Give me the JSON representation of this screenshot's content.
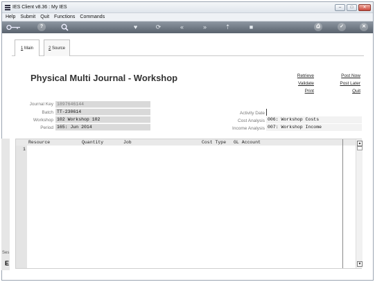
{
  "window": {
    "title": "IES Client v8.36 : My IES",
    "min_label": "–",
    "max_label": "□",
    "close_label": "✕"
  },
  "menu": [
    {
      "label": "Help"
    },
    {
      "label": "Submit"
    },
    {
      "label": "Quit"
    },
    {
      "label": "Functions"
    },
    {
      "label": "Commands"
    }
  ],
  "toolbar": {
    "icons": [
      "key-icon",
      "help-icon",
      "search-icon",
      "heart-icon",
      "refresh-icon",
      "rewind-icon",
      "fast-forward-icon",
      "upload-icon",
      "stop-icon",
      "print-icon",
      "ok-icon",
      "close-icon"
    ]
  },
  "tabs": {
    "main_label": "1 Main",
    "main_key": "1",
    "main_rest": " Main",
    "source_key": "2",
    "source_rest": " Source"
  },
  "page": {
    "title": "Physical Multi Journal - Workshop"
  },
  "actions": {
    "retrieve": "Retrieve",
    "validate": "Validate",
    "print": "Print",
    "post_now": "Post Now",
    "post_later": "Post Later",
    "quit": "Quit"
  },
  "fields": {
    "journal_key_label": "Journal Key",
    "journal_key_value": "1897646144",
    "batch_label": "Batch",
    "batch_value": "TT-230614",
    "workshop_label": "Workshop",
    "workshop_value": "102 Workshop 102",
    "period_label": "Period",
    "period_value": "165: Jun 2014",
    "activity_date_label": "Activity Date",
    "activity_date_value": "",
    "cost_analysis_label": "Cost Analysis",
    "cost_analysis_value": "006: Workshop Costs",
    "income_analysis_label": "Income Analysis",
    "income_analysis_value": "007: Workshop Income"
  },
  "grid": {
    "columns": [
      "Resource",
      "Quantity",
      "Job",
      "Cost Type",
      "GL Account"
    ],
    "rows": [
      {
        "num": "1"
      }
    ]
  },
  "sidebar": {
    "label": "Ses",
    "mark": "E"
  }
}
